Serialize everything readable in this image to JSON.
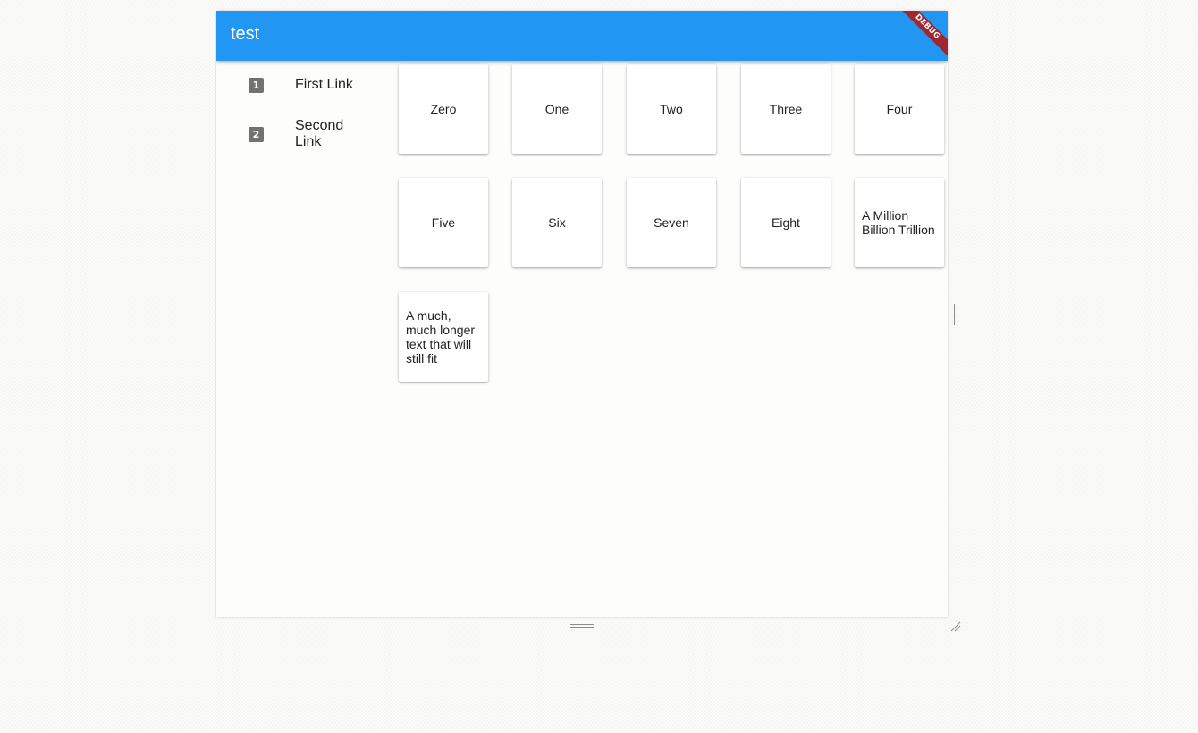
{
  "app_bar": {
    "title": "test",
    "debug_banner": "DEBUG",
    "color": "#2196f3"
  },
  "sidebar": {
    "items": [
      {
        "icon_label": "1",
        "label": "First Link",
        "icon": "number-1-icon"
      },
      {
        "icon_label": "2",
        "label": "Second Link",
        "icon": "number-2-icon"
      }
    ]
  },
  "grid": {
    "cards": [
      "Zero",
      "One",
      "Two",
      "Three",
      "Four",
      "Five",
      "Six",
      "Seven",
      "Eight",
      "A Million Billion Trillion",
      "A much, much longer text that will still fit"
    ]
  },
  "colors": {
    "debug_banner": "#a0262f",
    "nav_icon": "#727272"
  }
}
